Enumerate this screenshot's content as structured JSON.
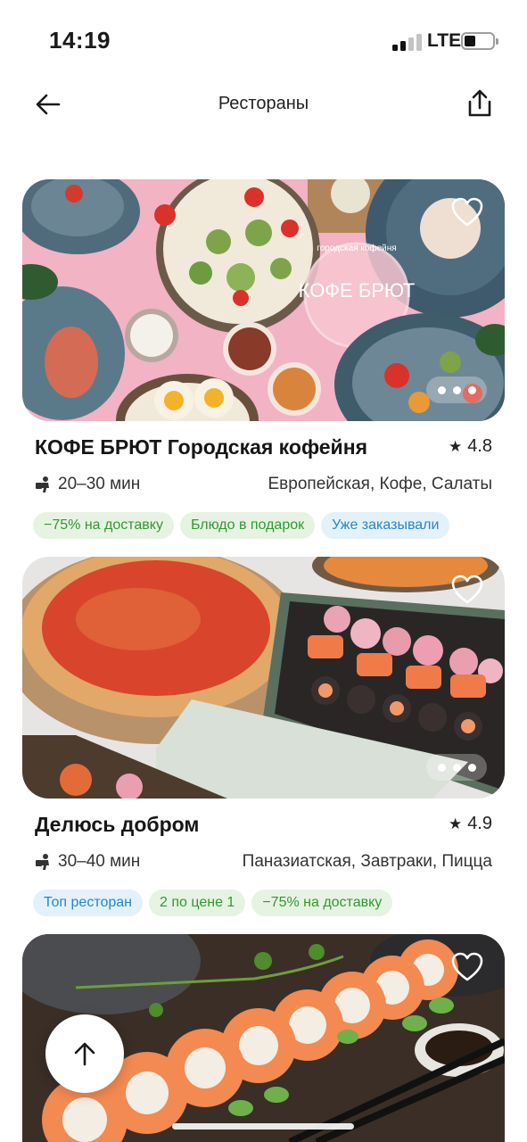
{
  "status_bar": {
    "time": "14:19",
    "network": "LTE"
  },
  "header": {
    "title": "Рестораны",
    "back_icon": "arrow-left-icon",
    "share_icon": "share-icon"
  },
  "restaurants": [
    {
      "name": "КОФЕ БРЮТ Городская кофейня",
      "rating": "4.8",
      "delivery_time": "20–30 мин",
      "cuisine": "Европейская, Кофе, Салаты",
      "photo_brand_text": "КОФЕ БРЮТ",
      "photo_ring_text": "городская кофейня",
      "tags": [
        {
          "label": "−75% на доставку",
          "color": "#2f9a2f"
        },
        {
          "label": "Блюдо в подарок",
          "color": "#2f9a2f"
        },
        {
          "label": "Уже заказывали",
          "color": "#2a86c9"
        }
      ]
    },
    {
      "name": "Делюсь добром",
      "rating": "4.9",
      "delivery_time": "30–40 мин",
      "cuisine": "Паназиатская, Завтраки, Пицца",
      "tags": [
        {
          "label": "Топ ресторан",
          "color": "#2a86c9"
        },
        {
          "label": "2 по цене 1",
          "color": "#2f9a2f"
        },
        {
          "label": "−75% на доставку",
          "color": "#2f9a2f"
        }
      ]
    }
  ],
  "colors": {
    "promo_green": "#2f9a2f",
    "info_blue": "#2a86c9",
    "card_pink": "#f3b7c6"
  }
}
